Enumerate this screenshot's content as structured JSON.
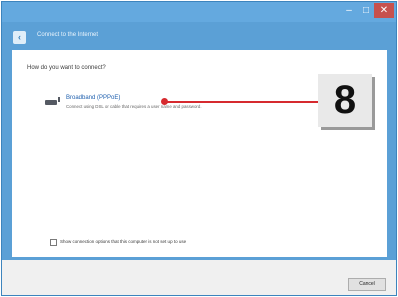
{
  "window": {
    "title": "",
    "controls": {
      "minimize": "–",
      "maximize": "□",
      "close": "✕"
    }
  },
  "header": {
    "back_icon": "back-arrow-icon",
    "back_glyph": "‹",
    "title": "Connect to the Internet"
  },
  "main": {
    "question": "How do you want to connect?",
    "options": [
      {
        "icon": "modem-icon",
        "title": "Broadband (PPPoE)",
        "description": "Connect using DSL or cable that requires a user name and password."
      }
    ],
    "show_all_options_label": "Show connection options that this computer is not set up to use",
    "show_all_options_checked": false
  },
  "callout": {
    "label": "8",
    "color": "#d62a2f"
  },
  "footer": {
    "cancel_label": "Cancel"
  },
  "colors": {
    "frame": "#5ba0d6",
    "title_link": "#1e5fae",
    "close_button": "#c7514e"
  }
}
